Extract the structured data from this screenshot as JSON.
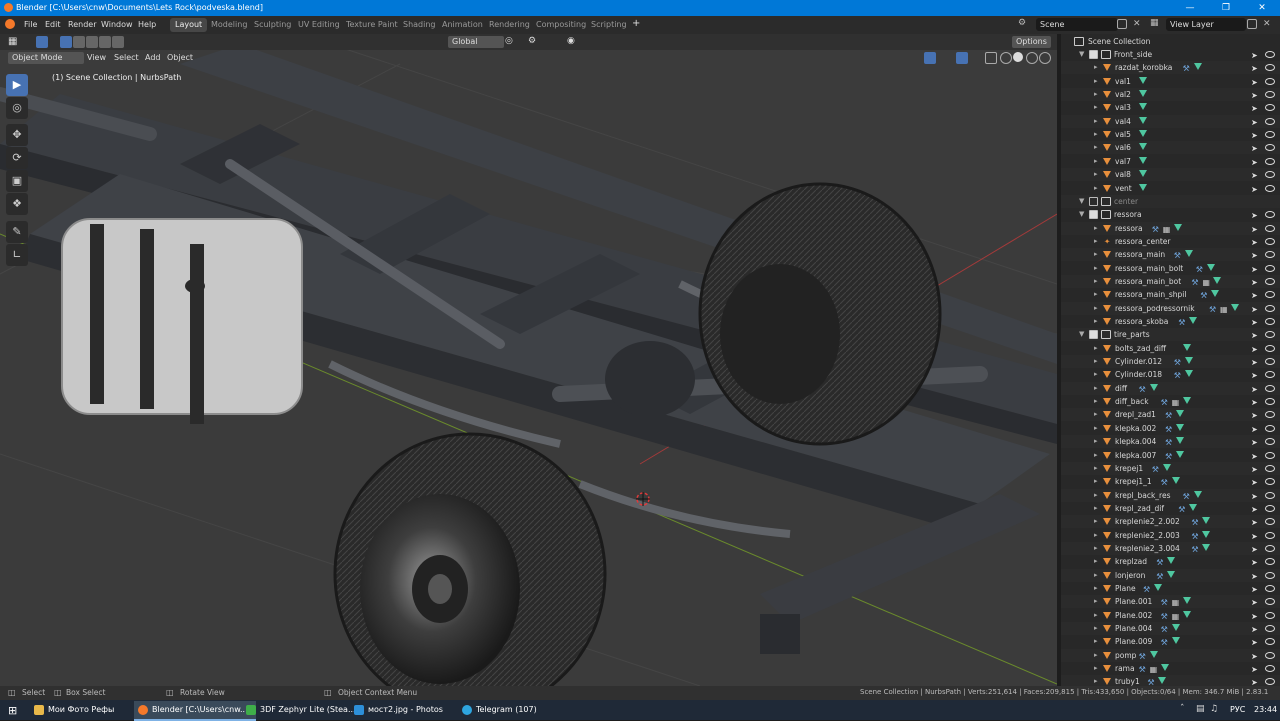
{
  "window": {
    "title": "Blender [C:\\Users\\cnw\\Documents\\Lets Rock\\podveska.blend]"
  },
  "menu": [
    "File",
    "Edit",
    "Render",
    "Window",
    "Help"
  ],
  "workspaces": [
    "Layout",
    "Modeling",
    "Sculpting",
    "UV Editing",
    "Texture Paint",
    "Shading",
    "Animation",
    "Rendering",
    "Compositing",
    "Scripting"
  ],
  "scene": {
    "name": "Scene",
    "view_layer": "View Layer"
  },
  "viewport": {
    "mode": "Object Mode",
    "menus": [
      "View",
      "Select",
      "Add",
      "Object"
    ],
    "orientation": "Global",
    "options": "Options",
    "overlay_text": "(1) Scene Collection | NurbsPath"
  },
  "outliner": {
    "title": "Scene Collection",
    "rows": [
      {
        "name": "Front_side",
        "kind": "collection",
        "indent": 0,
        "mods": ""
      },
      {
        "name": "razdat_korobka",
        "kind": "object",
        "indent": 1,
        "mods": "wm"
      },
      {
        "name": "val1",
        "kind": "object",
        "indent": 1,
        "mods": "m"
      },
      {
        "name": "val2",
        "kind": "object",
        "indent": 1,
        "mods": "m"
      },
      {
        "name": "val3",
        "kind": "object",
        "indent": 1,
        "mods": "m"
      },
      {
        "name": "val4",
        "kind": "object",
        "indent": 1,
        "mods": "m"
      },
      {
        "name": "val5",
        "kind": "object",
        "indent": 1,
        "mods": "m"
      },
      {
        "name": "val6",
        "kind": "object",
        "indent": 1,
        "mods": "m"
      },
      {
        "name": "val7",
        "kind": "object",
        "indent": 1,
        "mods": "m"
      },
      {
        "name": "val8",
        "kind": "object",
        "indent": 1,
        "mods": "m"
      },
      {
        "name": "vent",
        "kind": "object",
        "indent": 1,
        "mods": "m"
      },
      {
        "name": "center",
        "kind": "collection-off",
        "indent": 0,
        "mods": ""
      },
      {
        "name": "ressora",
        "kind": "collection",
        "indent": 0,
        "mods": ""
      },
      {
        "name": "ressora",
        "kind": "object",
        "indent": 1,
        "mods": "wgm"
      },
      {
        "name": "ressora_center",
        "kind": "empty",
        "indent": 1,
        "mods": ""
      },
      {
        "name": "ressora_main",
        "kind": "object",
        "indent": 1,
        "mods": "wm"
      },
      {
        "name": "ressora_main_bolt",
        "kind": "object",
        "indent": 1,
        "mods": "wm"
      },
      {
        "name": "ressora_main_bot",
        "kind": "object",
        "indent": 1,
        "mods": "wgm"
      },
      {
        "name": "ressora_main_shpil",
        "kind": "object",
        "indent": 1,
        "mods": "wm"
      },
      {
        "name": "ressora_podressornik",
        "kind": "object",
        "indent": 1,
        "mods": "wgm"
      },
      {
        "name": "ressora_skoba",
        "kind": "object",
        "indent": 1,
        "mods": "wm"
      },
      {
        "name": "tire_parts",
        "kind": "collection",
        "indent": 0,
        "mods": ""
      },
      {
        "name": "bolts_zad_diff",
        "kind": "object",
        "indent": 1,
        "mods": "m"
      },
      {
        "name": "Cylinder.012",
        "kind": "object",
        "indent": 1,
        "mods": "wm"
      },
      {
        "name": "Cylinder.018",
        "kind": "object",
        "indent": 1,
        "mods": "wm"
      },
      {
        "name": "diff",
        "kind": "object",
        "indent": 1,
        "mods": "wm"
      },
      {
        "name": "diff_back",
        "kind": "object",
        "indent": 1,
        "mods": "wgm"
      },
      {
        "name": "drepl_zad1",
        "kind": "object",
        "indent": 1,
        "mods": "wm"
      },
      {
        "name": "klepka.002",
        "kind": "object",
        "indent": 1,
        "mods": "wm"
      },
      {
        "name": "klepka.004",
        "kind": "object",
        "indent": 1,
        "mods": "wm"
      },
      {
        "name": "klepka.007",
        "kind": "object",
        "indent": 1,
        "mods": "wm"
      },
      {
        "name": "krepej1",
        "kind": "object",
        "indent": 1,
        "mods": "wm"
      },
      {
        "name": "krepej1_1",
        "kind": "object",
        "indent": 1,
        "mods": "wm"
      },
      {
        "name": "krepl_back_res",
        "kind": "object",
        "indent": 1,
        "mods": "wm"
      },
      {
        "name": "krepl_zad_dif",
        "kind": "object",
        "indent": 1,
        "mods": "wm"
      },
      {
        "name": "kreplenie2_2.002",
        "kind": "object",
        "indent": 1,
        "mods": "wm"
      },
      {
        "name": "kreplenie2_2.003",
        "kind": "object",
        "indent": 1,
        "mods": "wm"
      },
      {
        "name": "kreplenie2_3.004",
        "kind": "object",
        "indent": 1,
        "mods": "wm"
      },
      {
        "name": "kreplzad",
        "kind": "object",
        "indent": 1,
        "mods": "wm"
      },
      {
        "name": "lonjeron",
        "kind": "object",
        "indent": 1,
        "mods": "wm"
      },
      {
        "name": "Plane",
        "kind": "object",
        "indent": 1,
        "mods": "wm"
      },
      {
        "name": "Plane.001",
        "kind": "object",
        "indent": 1,
        "mods": "wgm"
      },
      {
        "name": "Plane.002",
        "kind": "object",
        "indent": 1,
        "mods": "wgm"
      },
      {
        "name": "Plane.004",
        "kind": "object",
        "indent": 1,
        "mods": "wm"
      },
      {
        "name": "Plane.009",
        "kind": "object",
        "indent": 1,
        "mods": "wm"
      },
      {
        "name": "pomp",
        "kind": "object",
        "indent": 1,
        "mods": "wm"
      },
      {
        "name": "rama",
        "kind": "object",
        "indent": 1,
        "mods": "wgm"
      },
      {
        "name": "truby1",
        "kind": "object",
        "indent": 1,
        "mods": "wm"
      }
    ]
  },
  "status": {
    "select": "Select",
    "box_select": "Box Select",
    "rotate": "Rotate View",
    "context": "Object Context Menu",
    "stats": "Scene Collection | NurbsPath | Verts:251,614 | Faces:209,815 | Tris:433,650 | Objects:0/64 | Mem: 346.7 MiB | 2.83.1"
  },
  "taskbar": {
    "items": [
      "Мои Фото Рефы",
      "Blender [C:\\Users\\cnw...",
      "3DF Zephyr Lite (Stea...",
      "мост2.jpg - Photos",
      "Telegram (107)"
    ],
    "lang": "РУС",
    "time": "23:44"
  },
  "colors": {
    "accent": "#4772b3",
    "titlebar": "#0078d7",
    "object_icon": "#e88f3c",
    "mesh_icon": "#4fc7a0"
  }
}
